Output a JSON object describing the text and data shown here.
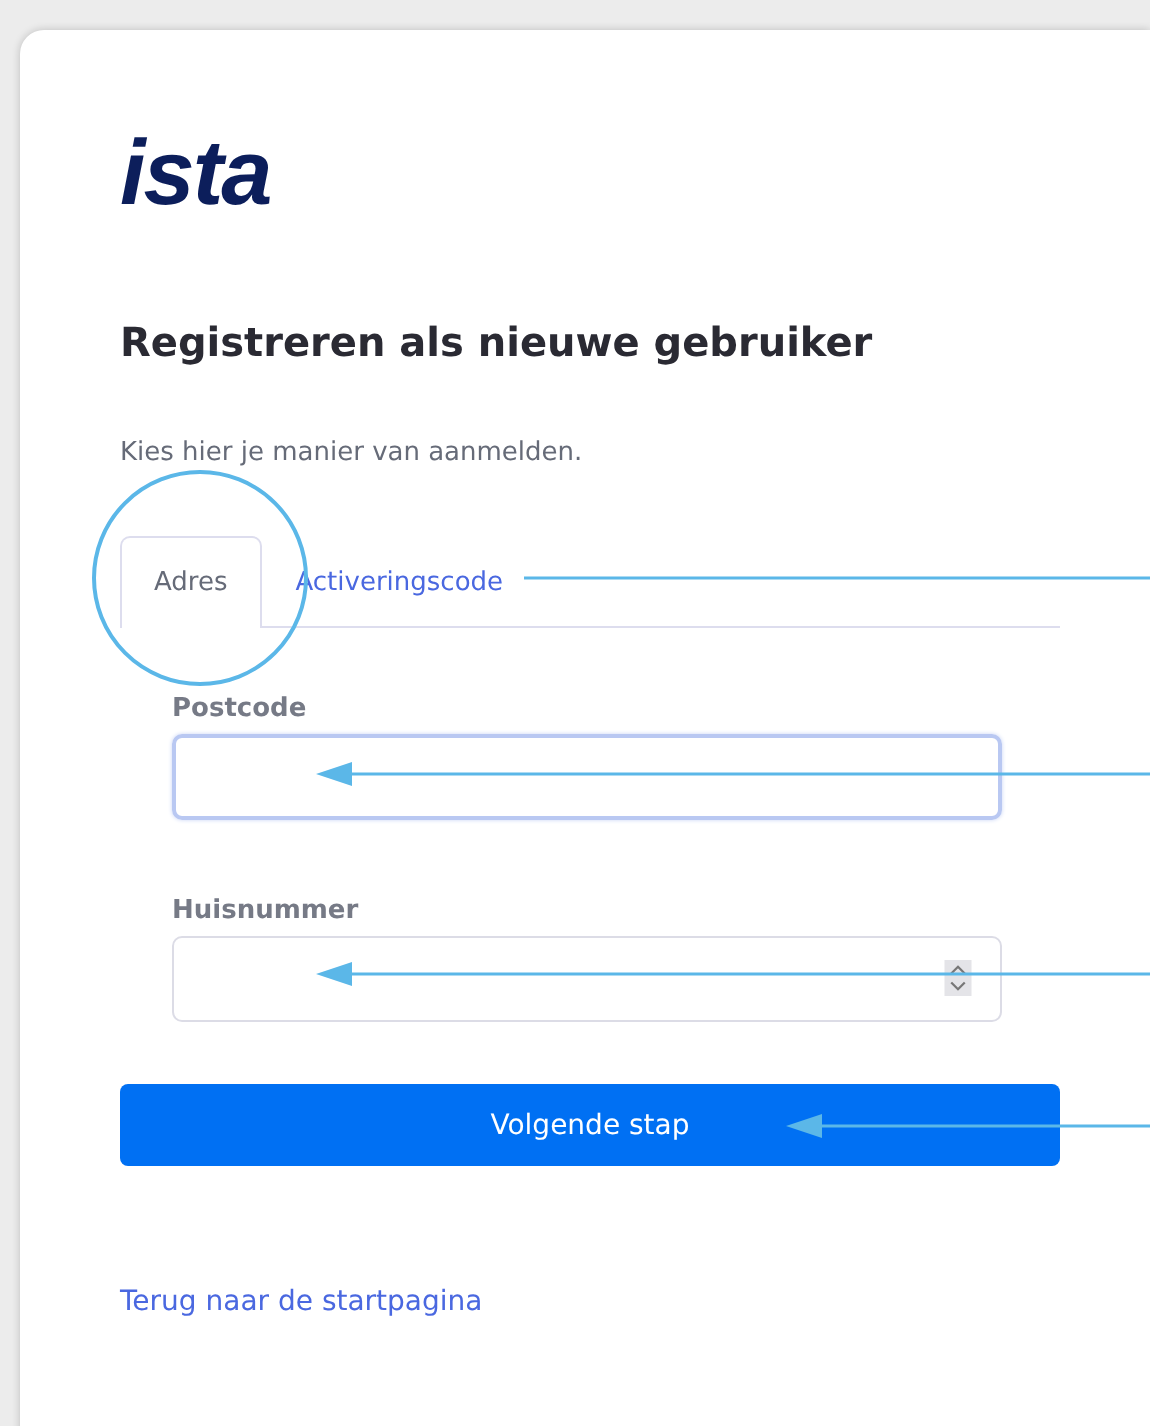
{
  "logo": "ista",
  "heading": "Registreren als nieuwe gebruiker",
  "instruction": "Kies hier je manier van aanmelden.",
  "tabs": [
    {
      "label": "Adres",
      "selected": true
    },
    {
      "label": "Activeringscode",
      "selected": false
    }
  ],
  "fields": [
    {
      "label": "Postcode",
      "kind": "text",
      "focused": true
    },
    {
      "label": "Huisnummer",
      "kind": "number",
      "focused": false
    }
  ],
  "submit_button": "Volgende stap",
  "back_link": "Terug naar de startpagina"
}
